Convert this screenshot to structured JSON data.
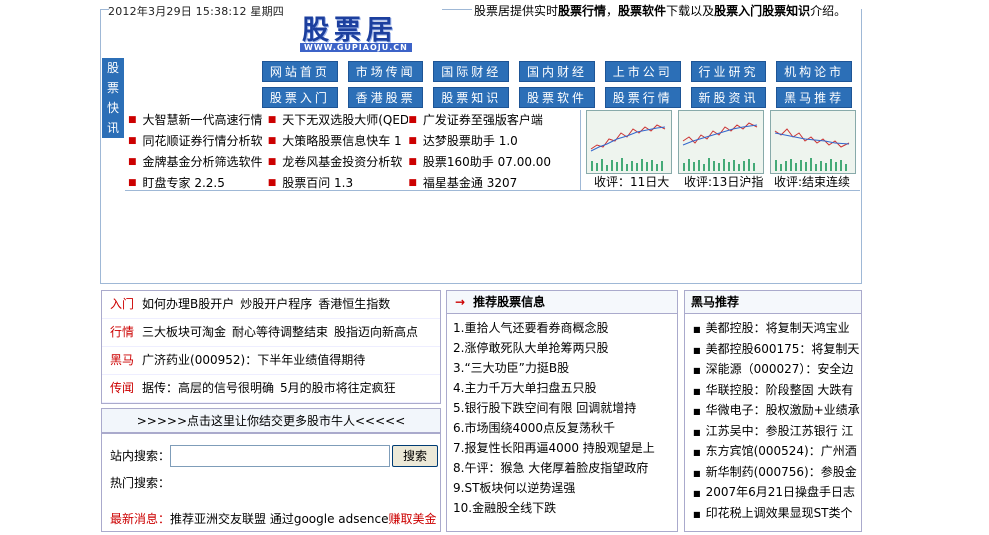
{
  "header": {
    "date": "2012年3月29日  15:38:12  星期四",
    "logo_text": "股票居",
    "logo_url": "WWW.GUPIAOJU.CN",
    "tagline_prefix": "股票居提供实时",
    "tagline_b1": "股票行情",
    "tagline_mid1": "，",
    "tagline_b2": "股票软件",
    "tagline_mid2": "下载以及",
    "tagline_b3": "股票入门股票知识",
    "tagline_suffix": "介绍。"
  },
  "side_label": [
    "股",
    "票",
    "快",
    "讯"
  ],
  "nav": {
    "row1": [
      "网站首页",
      "市场传闻",
      "国际财经",
      "国内财经",
      "上市公司",
      "行业研究",
      "机构论市"
    ],
    "row2": [
      "股票入门",
      "香港股票",
      "股票知识",
      "股票软件",
      "股票行情",
      "新股资讯",
      "黑马推荐"
    ]
  },
  "quick_list": [
    [
      "大智慧新一代高速行情",
      "天下无双选股大师(QED",
      "广发证券至强版客户端"
    ],
    [
      "同花顺证券行情分析软",
      "大策略股票信息快车 1",
      "达梦股票助手 1.0"
    ],
    [
      "金牌基金分析筛选软件",
      "龙卷风基金投资分析软",
      "股票160助手 07.00.00"
    ],
    [
      "盯盘专家 2.2.5",
      "股票百问 1.3",
      "福星基金通 3207"
    ]
  ],
  "thumbs": [
    {
      "caption": "收评：11日大"
    },
    {
      "caption": "收评:13日沪指"
    },
    {
      "caption": "收评:结束连续"
    }
  ],
  "left_news": [
    {
      "tag": "入门",
      "items": [
        "如何办理B股开户",
        "炒股开户程序",
        "香港恒生指数"
      ]
    },
    {
      "tag": "行情",
      "items": [
        "三大板块可淘金",
        "耐心等待调整结束",
        "股指迈向新高点"
      ]
    },
    {
      "tag": "黑马",
      "items": [
        "广济药业(000952)：下半年业绩值得期待"
      ]
    },
    {
      "tag": "传闻",
      "items": [
        "据传：高层的信号很明确",
        "5月的股市将往定疯狂"
      ]
    }
  ],
  "banner": ">>>>>点击这里让你结交更多股市牛人<<<<<",
  "search": {
    "label": "站内搜索：",
    "value": "",
    "button": "搜索",
    "hot_label": "热门搜索：",
    "latest_label": "最新消息：",
    "latest_text": "推荐亚洲交友联盟 通过google adsence",
    "latest_end": "赚取美金"
  },
  "mid": {
    "title": "推荐股票信息",
    "items": [
      "1.重拾人气还要看券商概念股",
      "2.涨停敢死队大单抢筹两只股",
      "3.“三大功臣”力挺B股",
      "4.主力千万大单扫盘五只股",
      "5.银行股下跌空间有限 回调就增持",
      "6.市场围绕4000点反复荡秋千",
      "7.报复性长阳再逼4000 持股观望是上",
      "8.午评：猴急 大佬厚着脸皮指望政府",
      "9.ST板块何以逆势逞强",
      "10.金融股全线下跌"
    ]
  },
  "right": {
    "title": "黑马推荐",
    "items": [
      "美都控股：将复制天鸿宝业",
      "美都控股600175：将复制天",
      "深能源（000027）：安全边",
      "华联控股：阶段整固 大跌有",
      "华微电子：股权激励+业绩承",
      "江苏吴中：参股江苏银行 江",
      "东方宾馆(000524)：广州酒",
      "新华制药(000756)：参股金",
      "2007年6月21日操盘手日志",
      "印花税上调效果显现ST类个"
    ]
  },
  "colors": {
    "nav_blue": "#2c6fb7",
    "accent_red": "#cc0000",
    "border": "#9fb8d6"
  }
}
